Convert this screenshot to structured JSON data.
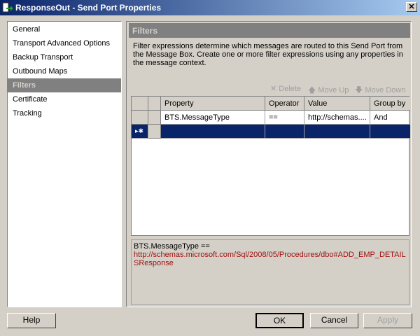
{
  "window": {
    "title": "ResponseOut - Send Port Properties",
    "close": "✕"
  },
  "nav": {
    "items": [
      {
        "label": "General"
      },
      {
        "label": "Transport Advanced Options"
      },
      {
        "label": "Backup Transport"
      },
      {
        "label": "Outbound Maps"
      },
      {
        "label": "Filters",
        "selected": true
      },
      {
        "label": "Certificate"
      },
      {
        "label": "Tracking"
      }
    ]
  },
  "panel": {
    "title": "Filters",
    "description": "Filter expressions determine which messages are routed to this Send Port from the Message Box. Create one or more filter expressions using any properties in the message context."
  },
  "toolbar": {
    "delete": "Delete",
    "move_up": "Move Up",
    "move_down": "Move Down"
  },
  "grid": {
    "columns": [
      "Property",
      "Operator",
      "Value",
      "Group by"
    ],
    "rows": [
      [
        "BTS.MessageType",
        "==",
        "http://schemas....",
        "And"
      ]
    ],
    "new_row_marker": "▸✱"
  },
  "details": {
    "expression": "BTS.MessageType ==",
    "value": "http://schemas.microsoft.com/Sql/2008/05/Procedures/dbo#ADD_EMP_DETAILSResponse"
  },
  "buttons": {
    "help": "Help",
    "ok": "OK",
    "cancel": "Cancel",
    "apply": "Apply"
  }
}
